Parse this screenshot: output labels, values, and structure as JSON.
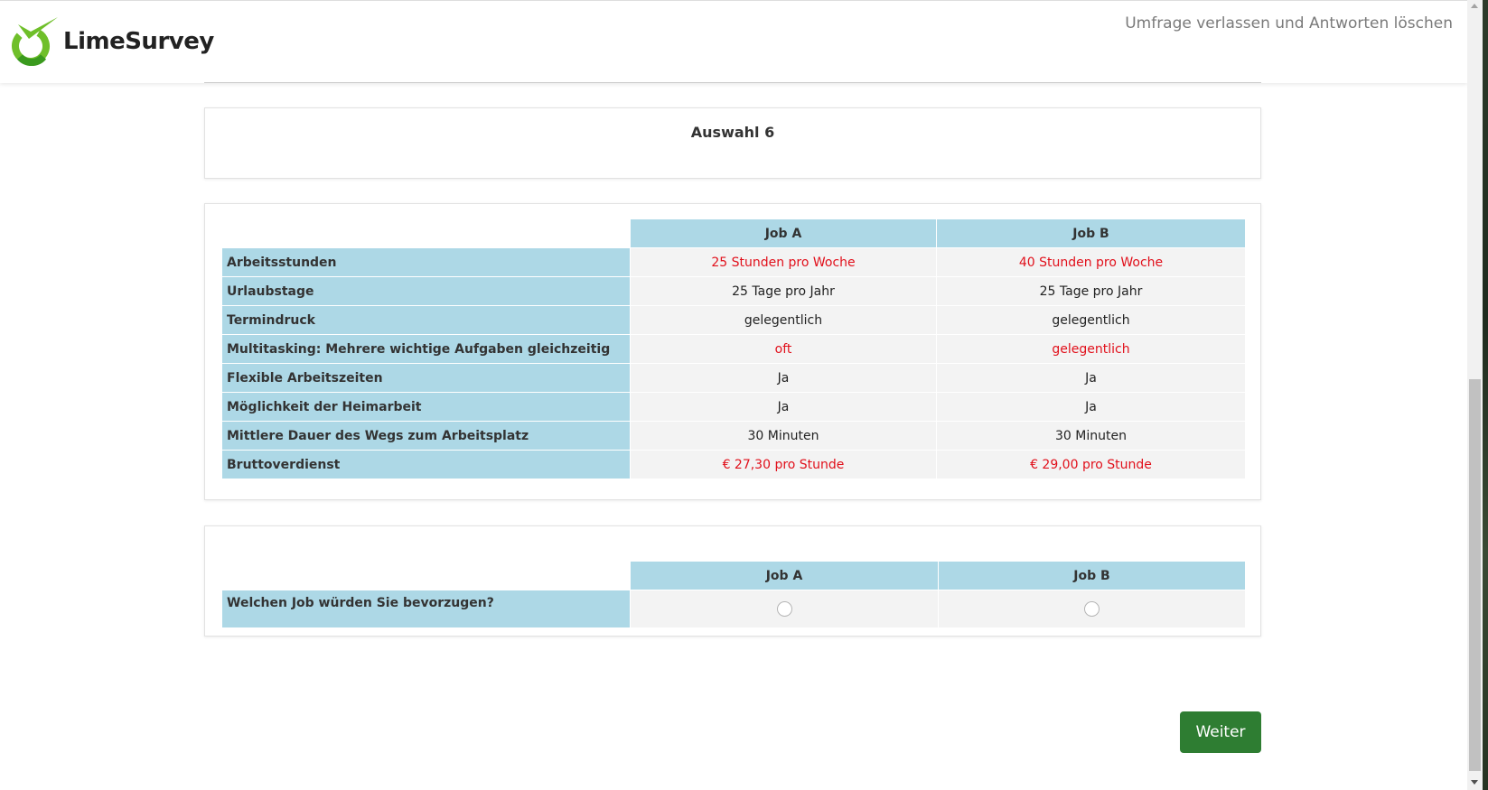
{
  "header": {
    "brand": "LimeSurvey",
    "exit_link": "Umfrage verlassen und Antworten löschen"
  },
  "section": {
    "title": "Auswahl 6"
  },
  "comparison": {
    "columns": [
      "Job A",
      "Job B"
    ],
    "rows": [
      {
        "label": "Arbeitsstunden",
        "a": "25 Stunden pro Woche",
        "b": "40 Stunden pro Woche",
        "highlight": true
      },
      {
        "label": "Urlaubstage",
        "a": "25 Tage pro Jahr",
        "b": "25 Tage pro Jahr",
        "highlight": false
      },
      {
        "label": "Termindruck",
        "a": "gelegentlich",
        "b": "gelegentlich",
        "highlight": false
      },
      {
        "label": "Multitasking: Mehrere wichtige Aufgaben gleichzeitig",
        "a": "oft",
        "b": "gelegentlich",
        "highlight": true
      },
      {
        "label": "Flexible Arbeitszeiten",
        "a": "Ja",
        "b": "Ja",
        "highlight": false
      },
      {
        "label": "Möglichkeit der Heimarbeit",
        "a": "Ja",
        "b": "Ja",
        "highlight": false
      },
      {
        "label": "Mittlere Dauer des Wegs zum Arbeitsplatz",
        "a": "30 Minuten",
        "b": "30 Minuten",
        "highlight": false
      },
      {
        "label": "Bruttoverdienst",
        "a": "€ 27,30 pro Stunde",
        "b": "€ 29,00 pro Stunde",
        "highlight": true
      }
    ]
  },
  "question": {
    "columns": [
      "Job A",
      "Job B"
    ],
    "label": "Welchen Job würden Sie bevorzugen?",
    "selected": null
  },
  "navigation": {
    "next_label": "Weiter"
  },
  "colors": {
    "header_bg": "#add8e6",
    "highlight_text": "#e1101b",
    "button_bg": "#2e7d32",
    "brand_green": "#6fbf2a"
  }
}
